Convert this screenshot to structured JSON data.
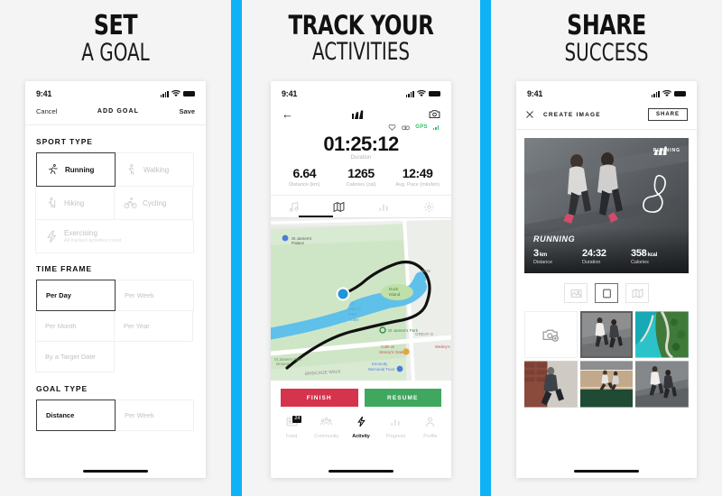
{
  "panels": [
    {
      "headline_top": "SET",
      "headline_bottom": "A GOAL",
      "status": {
        "time": "9:41"
      },
      "nav": {
        "left": "Cancel",
        "title": "ADD GOAL",
        "right": "Save"
      },
      "sections": [
        {
          "title": "SPORT TYPE",
          "tiles": [
            {
              "label": "Running",
              "icon": "running-icon",
              "selected": true,
              "sub": ""
            },
            {
              "label": "Walking",
              "icon": "walking-icon",
              "selected": false,
              "sub": ""
            },
            {
              "label": "Hiking",
              "icon": "hiking-icon",
              "selected": false,
              "sub": ""
            },
            {
              "label": "Cycling",
              "icon": "cycling-icon",
              "selected": false,
              "sub": ""
            },
            {
              "label": "Exercising",
              "icon": "exercising-icon",
              "selected": false,
              "sub": "All tracked activities count",
              "wide": true
            }
          ]
        },
        {
          "title": "TIME FRAME",
          "tiles": [
            {
              "label": "Per Day",
              "selected": true
            },
            {
              "label": "Per Week",
              "selected": false
            },
            {
              "label": "Per Month",
              "selected": false
            },
            {
              "label": "Per Year",
              "selected": false
            },
            {
              "label": "By a Target Date",
              "selected": false
            }
          ]
        },
        {
          "title": "GOAL TYPE",
          "tiles": [
            {
              "label": "Distance",
              "selected": true
            },
            {
              "label": "Per Week",
              "selected": false
            }
          ]
        }
      ]
    },
    {
      "headline_top": "TRACK YOUR",
      "headline_bottom": "ACTIVITIES",
      "status": {
        "time": "9:41"
      },
      "header": {
        "back": "back-arrow-icon",
        "brand": "adidas-logo",
        "camera": "camera-icon"
      },
      "sensors": {
        "heart": "heart-icon",
        "shoe": "shoe-pod-icon",
        "gps_label": "GPS",
        "gps_color": "#2fbf63"
      },
      "duration": {
        "value": "01:25:12",
        "label": "Duration"
      },
      "stats": [
        {
          "value": "6.64",
          "label": "Distance (km)"
        },
        {
          "value": "1265",
          "label": "Calories (cal)"
        },
        {
          "value": "12:49",
          "label": "Avg. Pace (min/km)"
        }
      ],
      "media_tabs": [
        {
          "icon": "music-icon",
          "active": false
        },
        {
          "icon": "map-icon",
          "active": true
        },
        {
          "icon": "chart-icon",
          "active": false
        },
        {
          "icon": "settings-icon",
          "active": false
        }
      ],
      "map": {
        "labels": [
          "St James's Palace",
          "Duck Island",
          "St James's Park Lake",
          "St James's Park",
          "Cafe at Storey's Gate",
          "Kennedy Memorial Trust",
          "BIRDCAGE WALK",
          "GREAT G",
          "St James's Park Ground",
          "Wesley's Cafe"
        ]
      },
      "buttons": [
        {
          "label": "FINISH",
          "color": "#d6334d"
        },
        {
          "label": "RESUME",
          "color": "#3fa85e"
        }
      ],
      "tabbar": [
        {
          "label": "Feed",
          "icon": "feed-icon",
          "active": false,
          "badge": "24"
        },
        {
          "label": "Community",
          "icon": "community-icon",
          "active": false,
          "badge": ""
        },
        {
          "label": "Activity",
          "icon": "activity-icon",
          "active": true,
          "badge": ""
        },
        {
          "label": "Progress",
          "icon": "progress-icon",
          "active": false,
          "badge": ""
        },
        {
          "label": "Profile",
          "icon": "profile-icon",
          "active": false,
          "badge": ""
        }
      ]
    },
    {
      "headline_top": "SHARE",
      "headline_bottom": "SUCCESS",
      "status": {
        "time": "9:41"
      },
      "nav": {
        "close": "close-icon",
        "title": "CREATE IMAGE",
        "share": "SHARE"
      },
      "hero": {
        "brand": "adidas-logo",
        "brand_word": "RUNNING",
        "sport": "RUNNING",
        "stats": [
          {
            "value": "3",
            "unit": "km",
            "label": "Distance"
          },
          {
            "value": "24:32",
            "unit": "",
            "label": "Duration"
          },
          {
            "value": "358",
            "unit": "kcal",
            "label": "Calories"
          }
        ]
      },
      "formats": [
        {
          "icon": "landscape-icon",
          "active": false
        },
        {
          "icon": "square-icon",
          "active": true
        },
        {
          "icon": "map-icon",
          "active": false
        }
      ],
      "gallery": [
        {
          "type": "add-photo",
          "selected": false
        },
        {
          "type": "runners-street",
          "selected": true
        },
        {
          "type": "coastal-road",
          "selected": false
        },
        {
          "type": "runner-wall",
          "selected": false
        },
        {
          "type": "track-runner",
          "selected": false
        },
        {
          "type": "runners-pair",
          "selected": false
        }
      ]
    }
  ],
  "theme": {
    "accent": "#0fb2f5",
    "background": "#f4f4f4",
    "card": "#ffffff"
  }
}
